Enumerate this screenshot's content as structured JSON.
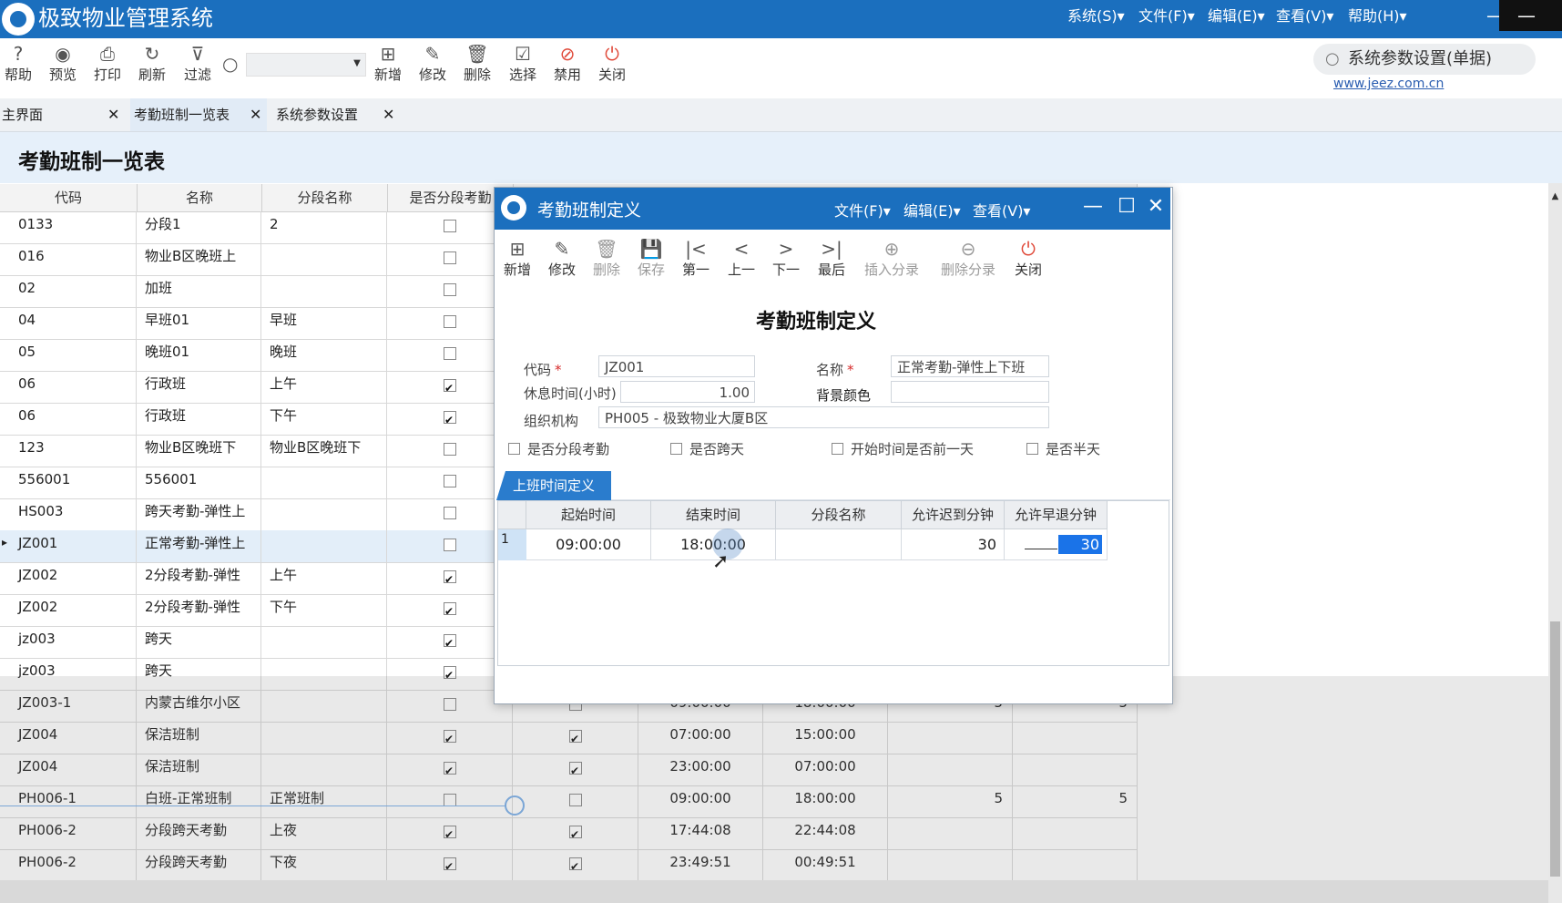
{
  "app": {
    "title": "极致物业管理系统",
    "menus": [
      "系统(S)▾",
      "文件(F)▾",
      "编辑(E)▾",
      "查看(V)▾",
      "帮助(H)▾"
    ],
    "min_glyph": "—",
    "accent": "#1b6fbe"
  },
  "toolbar": {
    "buttons": [
      {
        "label": "帮助",
        "icon": "help-icon",
        "glyph": "?"
      },
      {
        "label": "预览",
        "icon": "eye-icon",
        "glyph": "◉"
      },
      {
        "label": "打印",
        "icon": "printer-icon",
        "glyph": "⎙"
      },
      {
        "label": "刷新",
        "icon": "refresh-icon",
        "glyph": "↻"
      },
      {
        "label": "过滤",
        "icon": "filter-icon",
        "glyph": "⊽"
      },
      {
        "label": "新增",
        "icon": "add-icon",
        "glyph": "⊞"
      },
      {
        "label": "修改",
        "icon": "edit-icon",
        "glyph": "✎"
      },
      {
        "label": "删除",
        "icon": "trash-icon",
        "glyph": "🗑"
      },
      {
        "label": "选择",
        "icon": "select-icon",
        "glyph": "☑"
      },
      {
        "label": "禁用",
        "icon": "ban-icon",
        "glyph": "⊘"
      },
      {
        "label": "关闭",
        "icon": "power-icon",
        "glyph": "⏻"
      }
    ],
    "search_glyph": "○",
    "combo_arrow": "▼",
    "top_search": "系统参数设置(单据)",
    "top_search_glyph": "○",
    "site_link": "www.jeez.com.cn"
  },
  "tabs": [
    {
      "label": "主界面",
      "active": false
    },
    {
      "label": "考勤班制一览表",
      "active": true
    },
    {
      "label": "系统参数设置",
      "active": false
    }
  ],
  "tab_close_glyph": "✕",
  "page": {
    "title": "考勤班制一览表"
  },
  "grid": {
    "columns": [
      "代码",
      "名称",
      "分段名称",
      "是否分段考勤"
    ],
    "rows": [
      {
        "code": "0133",
        "name": "分段1",
        "seg": "2",
        "split": false,
        "c5": false,
        "start": "",
        "end": "",
        "late": "",
        "early": ""
      },
      {
        "code": "016",
        "name": "物业B区晚班上",
        "seg": "",
        "split": false,
        "c5": false,
        "start": "",
        "end": "",
        "late": "",
        "early": ""
      },
      {
        "code": "02",
        "name": "加班",
        "seg": "",
        "split": false,
        "c5": false,
        "start": "",
        "end": "",
        "late": "",
        "early": ""
      },
      {
        "code": "04",
        "name": "早班01",
        "seg": "早班",
        "split": false,
        "c5": false,
        "start": "",
        "end": "",
        "late": "",
        "early": ""
      },
      {
        "code": "05",
        "name": "晚班01",
        "seg": "晚班",
        "split": false,
        "c5": false,
        "start": "",
        "end": "",
        "late": "",
        "early": ""
      },
      {
        "code": "06",
        "name": "行政班",
        "seg": "上午",
        "split": true,
        "c5": false,
        "start": "",
        "end": "",
        "late": "",
        "early": ""
      },
      {
        "code": "06",
        "name": "行政班",
        "seg": "下午",
        "split": true,
        "c5": false,
        "start": "",
        "end": "",
        "late": "",
        "early": ""
      },
      {
        "code": "123",
        "name": "物业B区晚班下",
        "seg": "物业B区晚班下",
        "split": false,
        "c5": false,
        "start": "",
        "end": "",
        "late": "",
        "early": ""
      },
      {
        "code": "556001",
        "name": "556001",
        "seg": "",
        "split": false,
        "c5": false,
        "start": "",
        "end": "",
        "late": "",
        "early": ""
      },
      {
        "code": "HS003",
        "name": "跨天考勤-弹性上",
        "seg": "",
        "split": false,
        "c5": false,
        "start": "",
        "end": "",
        "late": "",
        "early": ""
      },
      {
        "code": "JZ001",
        "name": "正常考勤-弹性上",
        "seg": "",
        "split": false,
        "c5": false,
        "start": "",
        "end": "",
        "late": "",
        "early": "",
        "selected": true
      },
      {
        "code": "JZ002",
        "name": "2分段考勤-弹性",
        "seg": "上午",
        "split": true,
        "c5": false,
        "start": "",
        "end": "",
        "late": "",
        "early": ""
      },
      {
        "code": "JZ002",
        "name": "2分段考勤-弹性",
        "seg": "下午",
        "split": true,
        "c5": false,
        "start": "",
        "end": "",
        "late": "",
        "early": ""
      },
      {
        "code": "jz003",
        "name": "跨天",
        "seg": "",
        "split": true,
        "c5": false,
        "start": "",
        "end": "",
        "late": "",
        "early": ""
      },
      {
        "code": "jz003",
        "name": "跨天",
        "seg": "",
        "split": true,
        "c5": false,
        "start": "",
        "end": "",
        "late": "",
        "early": ""
      },
      {
        "code": "JZ003-1",
        "name": "内蒙古维尔小区",
        "seg": "",
        "split": false,
        "c5": false,
        "start": "09:00:00",
        "end": "18:00:00",
        "late": "5",
        "early": "5"
      },
      {
        "code": "JZ004",
        "name": "保洁班制",
        "seg": "",
        "split": true,
        "c5": true,
        "start": "07:00:00",
        "end": "15:00:00",
        "late": "",
        "early": ""
      },
      {
        "code": "JZ004",
        "name": "保洁班制",
        "seg": "",
        "split": true,
        "c5": true,
        "start": "23:00:00",
        "end": "07:00:00",
        "late": "",
        "early": ""
      },
      {
        "code": "PH006-1",
        "name": "白班-正常班制",
        "seg": "正常班制",
        "split": false,
        "c5": false,
        "start": "09:00:00",
        "end": "18:00:00",
        "late": "5",
        "early": "5"
      },
      {
        "code": "PH006-2",
        "name": "分段跨天考勤",
        "seg": "上夜",
        "split": true,
        "c5": true,
        "start": "17:44:08",
        "end": "22:44:08",
        "late": "",
        "early": ""
      },
      {
        "code": "PH006-2",
        "name": "分段跨天考勤",
        "seg": "下夜",
        "split": true,
        "c5": true,
        "start": "23:49:51",
        "end": "00:49:51",
        "late": "",
        "early": ""
      }
    ],
    "row_pointer": "▸"
  },
  "dialog": {
    "title": "考勤班制定义",
    "menus": [
      "文件(F)▾",
      "编辑(E)▾",
      "查看(V)▾"
    ],
    "win_min": "—",
    "win_max": "☐",
    "win_close": "✕",
    "toolbar": [
      {
        "label": "新增",
        "icon": "add-icon",
        "glyph": "⊞",
        "disabled": false
      },
      {
        "label": "修改",
        "icon": "edit-icon",
        "glyph": "✎",
        "disabled": false
      },
      {
        "label": "删除",
        "icon": "trash-icon",
        "glyph": "🗑",
        "disabled": true
      },
      {
        "label": "保存",
        "icon": "save-icon",
        "glyph": "💾",
        "disabled": true
      },
      {
        "label": "第一",
        "icon": "first-icon",
        "glyph": "|<",
        "disabled": false
      },
      {
        "label": "上一",
        "icon": "prev-icon",
        "glyph": "<",
        "disabled": false
      },
      {
        "label": "下一",
        "icon": "next-icon",
        "glyph": ">",
        "disabled": false
      },
      {
        "label": "最后",
        "icon": "last-icon",
        "glyph": ">|",
        "disabled": false
      },
      {
        "label": "插入分录",
        "icon": "insert-row-icon",
        "glyph": "⊕",
        "disabled": true
      },
      {
        "label": "删除分录",
        "icon": "delete-row-icon",
        "glyph": "⊖",
        "disabled": true
      },
      {
        "label": "关闭",
        "icon": "power-icon",
        "glyph": "⏻",
        "disabled": false
      }
    ],
    "form_title": "考勤班制定义",
    "fields": {
      "code_label": "代码",
      "code_value": "JZ001",
      "name_label": "名称",
      "name_value": "正常考勤-弹性上下班",
      "rest_label": "休息时间(小时)",
      "rest_value": "1.00",
      "bg_label": "背景颜色",
      "org_label": "组织机构",
      "org_value": "PH005 - 极致物业大厦B区",
      "required_mark": "*"
    },
    "checks": [
      "是否分段考勤",
      "是否跨天",
      "开始时间是否前一天",
      "是否半天"
    ],
    "tab": "上班时间定义",
    "detail_columns": [
      "起始时间",
      "结束时间",
      "分段名称",
      "允许迟到分钟",
      "允许早退分钟"
    ],
    "detail_rows": [
      {
        "no": "1",
        "start": "09:00:00",
        "end": "18:00:00",
        "seg": "",
        "late": "30",
        "early": "30"
      }
    ]
  }
}
